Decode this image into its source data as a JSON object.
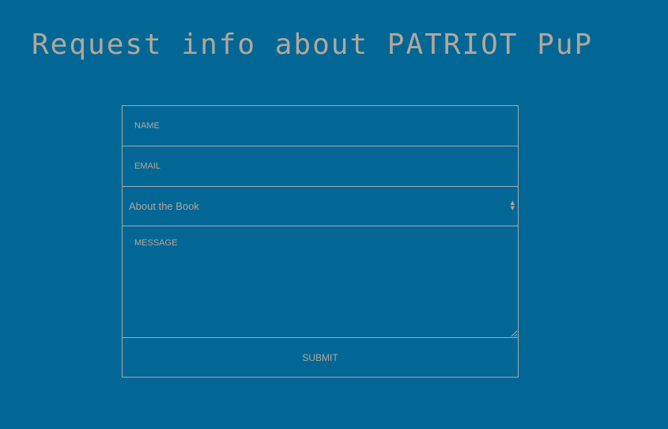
{
  "header": {
    "title": "Request info about PATRIOT PuP"
  },
  "form": {
    "name_placeholder": "NAME",
    "email_placeholder": "EMAIL",
    "subject_selected": "About the Book",
    "message_placeholder": "MESSAGE",
    "submit_label": "SUBMIT"
  },
  "colors": {
    "background": "#036796",
    "text": "#b3a79a",
    "border": "#a6a9b0"
  }
}
